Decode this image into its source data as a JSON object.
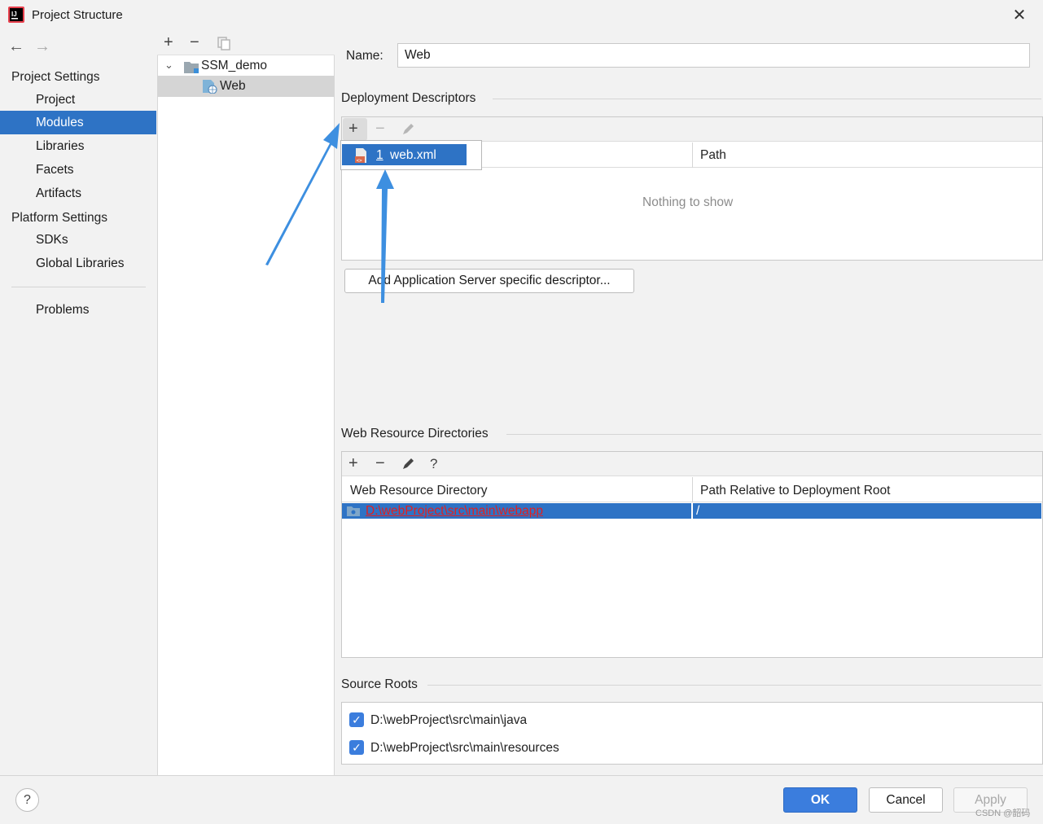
{
  "window": {
    "title": "Project Structure",
    "close_icon": "close-icon"
  },
  "nav": {
    "project_settings_header": "Project Settings",
    "project_items": [
      "Project",
      "Modules",
      "Libraries",
      "Facets",
      "Artifacts"
    ],
    "selected_item": "Modules",
    "platform_settings_header": "Platform Settings",
    "platform_items": [
      "SDKs",
      "Global Libraries"
    ],
    "problems": "Problems"
  },
  "tree": {
    "toolbar": [
      "plus-icon",
      "minus-icon",
      "copy-icon"
    ],
    "root": "SSM_demo",
    "child": "Web"
  },
  "content": {
    "name_label": "Name:",
    "name_value": "Web",
    "deployment_descriptors": {
      "title": "Deployment Descriptors",
      "columns": [
        "Path"
      ],
      "empty_text": "Nothing to show",
      "popup_item_number": "1",
      "popup_item_label": "web.xml"
    },
    "add_server_button": "Add Application Server specific descriptor...",
    "web_resource_dirs": {
      "title": "Web Resource Directories",
      "columns": [
        "Web Resource Directory",
        "Path Relative to Deployment Root"
      ],
      "rows": [
        {
          "directory": "D:\\webProject\\src\\main\\webapp",
          "path": "/"
        }
      ]
    },
    "source_roots": {
      "title": "Source Roots",
      "items": [
        {
          "path": "D:\\webProject\\src\\main\\java",
          "checked": true
        },
        {
          "path": "D:\\webProject\\src\\main\\resources",
          "checked": true
        }
      ]
    }
  },
  "buttons": {
    "help": "?",
    "ok": "OK",
    "cancel": "Cancel",
    "apply": "Apply"
  },
  "watermark": "CSDN @韶码",
  "colors": {
    "selection": "#2e73c5",
    "annotation_arrow": "#3d8fe0",
    "error_path": "#e02020"
  }
}
